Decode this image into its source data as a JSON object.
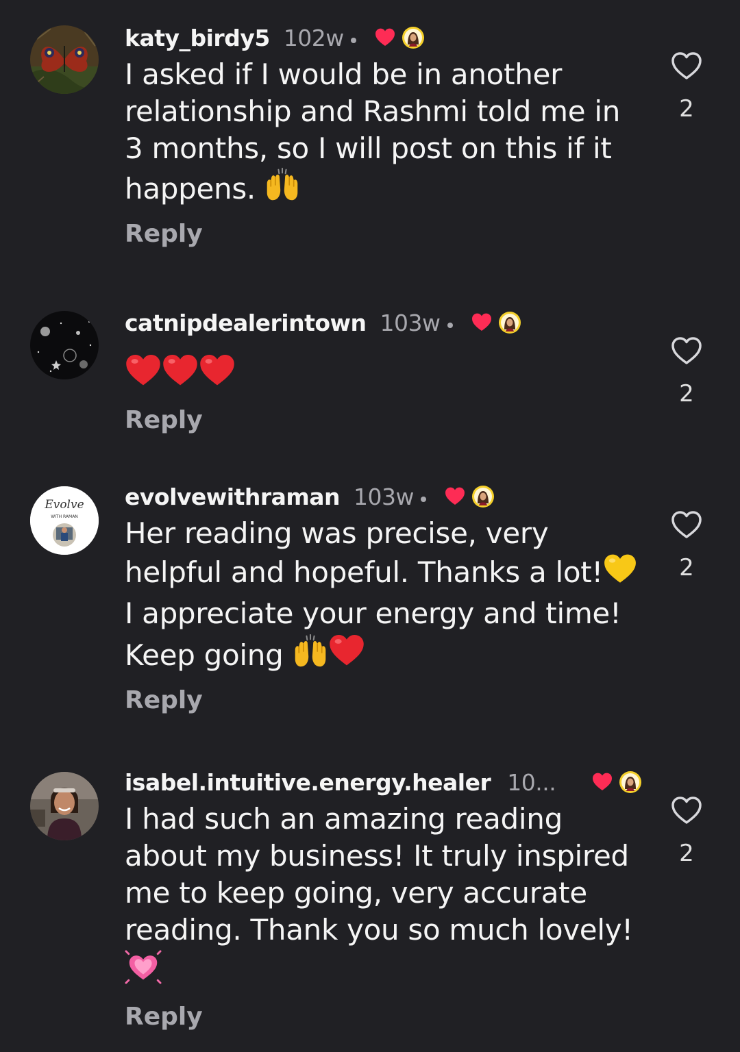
{
  "theme": {
    "background": "#202024",
    "accent_red": "#fe2c55",
    "muted_text": "#a8a8ae"
  },
  "comments": [
    {
      "username": "katy_birdy5",
      "time": "102w",
      "text_lines": [
        "I asked if I would be in another",
        "relationship and Rashmi told me in",
        "3 months, so I will post on this if it",
        "happens."
      ],
      "trailing_emoji": [
        "raising-hands"
      ],
      "reply_label": "Reply",
      "like_count": "2",
      "liked_by_creator": true,
      "avatar_icon": "butterfly-avatar"
    },
    {
      "username": "catnipdealerintown",
      "time": "103w",
      "text_lines": [],
      "trailing_emoji": [
        "red-heart",
        "red-heart",
        "red-heart"
      ],
      "reply_label": "Reply",
      "like_count": "2",
      "liked_by_creator": true,
      "avatar_icon": "space-avatar"
    },
    {
      "username": "evolvewithraman",
      "time": "103w",
      "text_lines": [
        "Her reading was precise, very",
        "helpful and hopeful. Thanks a lot!",
        "I appreciate your energy and time!",
        "Keep going"
      ],
      "trailing_emoji": [
        "raising-hands",
        "red-heart"
      ],
      "reply_label": "Reply",
      "like_count": "2",
      "liked_by_creator": true,
      "avatar_icon": "evolve-logo-avatar",
      "avatar_logo_text": "Evolve",
      "avatar_logo_subtext": "WITH RAMAN"
    },
    {
      "username": "isabel.intuitive.energy.healer",
      "time": "10...",
      "text_lines": [
        "I had such an amazing reading",
        "about my business! It truly inspired",
        "me to keep going, very accurate",
        "reading. Thank you so much lovely!"
      ],
      "trailing_emoji": [
        "growing-heart"
      ],
      "reply_label": "Reply",
      "like_count": "2",
      "liked_by_creator": true,
      "avatar_icon": "person-photo-avatar"
    }
  ]
}
